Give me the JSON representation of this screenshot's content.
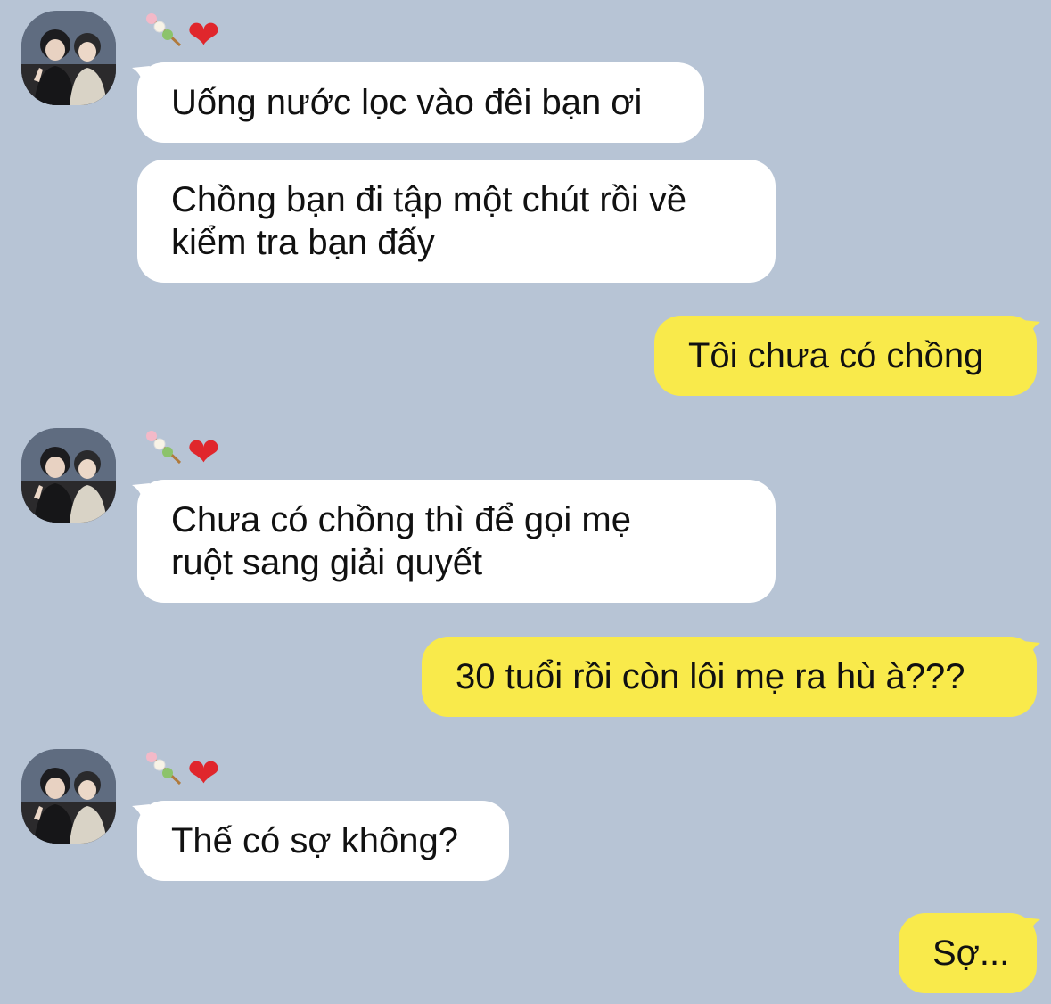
{
  "colors": {
    "background": "#b7c4d5",
    "incoming_bubble": "#ffffff",
    "outgoing_bubble": "#f9ea4b",
    "heart": "#e0262c"
  },
  "sender": {
    "name_emoji": [
      "dango-icon",
      "red-heart-icon"
    ],
    "heart_glyph": "❤"
  },
  "messages": [
    {
      "side": "in",
      "text": "Uống nước lọc vào đêi bạn ơi"
    },
    {
      "side": "in",
      "text": "Chồng bạn đi tập một chút rồi về\nkiểm tra bạn đấy"
    },
    {
      "side": "out",
      "text": "Tôi chưa có chồng"
    },
    {
      "side": "in",
      "text": "Chưa có chồng thì để gọi mẹ\nruột sang giải quyết"
    },
    {
      "side": "out",
      "text": "30 tuổi rồi còn lôi mẹ ra hù à???"
    },
    {
      "side": "in",
      "text": "Thế có sợ không?"
    },
    {
      "side": "out",
      "text": "Sợ..."
    }
  ]
}
